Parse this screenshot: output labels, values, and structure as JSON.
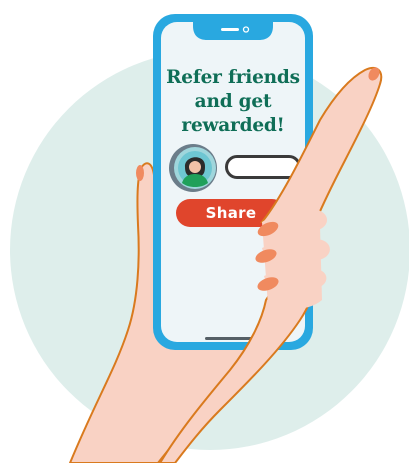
{
  "screen": {
    "headline": "Refer friends\nand get\nrewarded!",
    "share_label": "Share",
    "input_placeholder": ""
  },
  "colors": {
    "circle_bg": "#deeeeb",
    "phone_frame": "#29a8e0",
    "screen": "#eef5f8",
    "headline": "#0f6e57",
    "share_button": "#e0452c",
    "skin": "#f9d2c4",
    "nails": "#f08a5f",
    "outline": "#d97a1e"
  },
  "icons": {
    "avatar": "person-avatar-icon",
    "notch": "phone-notch-icon",
    "home_indicator": "home-bar-icon"
  }
}
